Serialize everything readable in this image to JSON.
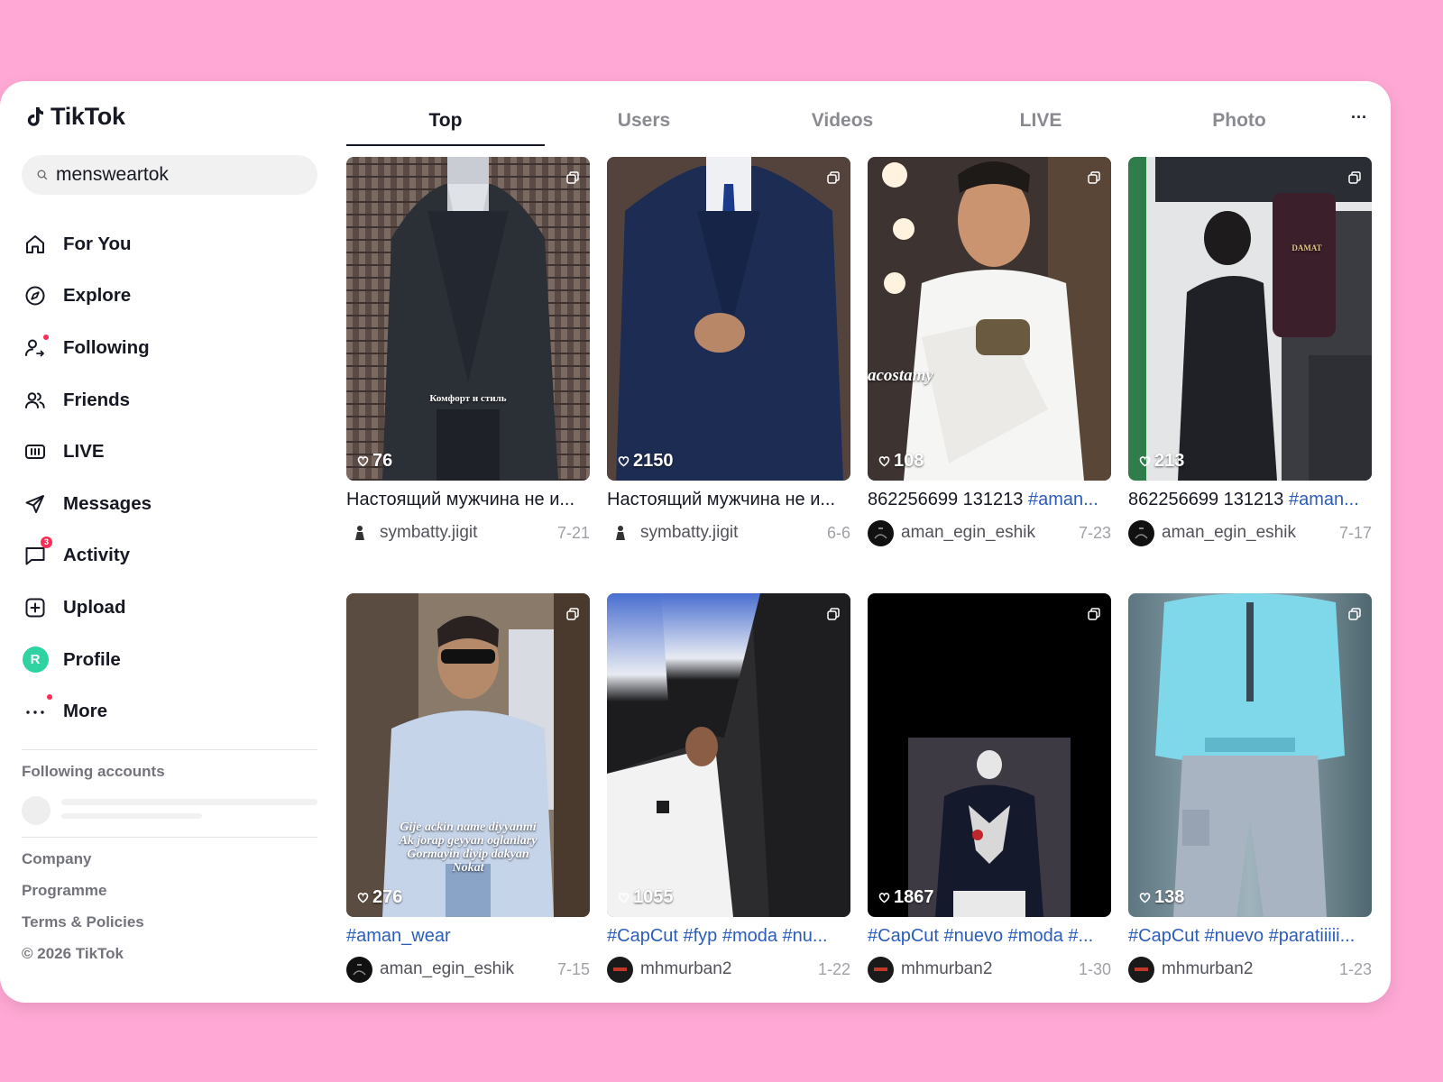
{
  "app": {
    "name": "TikTok"
  },
  "search": {
    "value": "mensweartok"
  },
  "nav": [
    {
      "label": "For You",
      "icon": "home-icon"
    },
    {
      "label": "Explore",
      "icon": "compass-icon"
    },
    {
      "label": "Following",
      "icon": "following-icon"
    },
    {
      "label": "Friends",
      "icon": "friends-icon"
    },
    {
      "label": "LIVE",
      "icon": "live-icon"
    },
    {
      "label": "Messages",
      "icon": "send-icon"
    },
    {
      "label": "Activity",
      "icon": "chat-icon",
      "badge": "3"
    },
    {
      "label": "Upload",
      "icon": "upload-icon"
    },
    {
      "label": "Profile",
      "icon": "avatar",
      "avatar_letter": "R"
    },
    {
      "label": "More",
      "icon": "more-icon"
    }
  ],
  "following_accounts": {
    "title": "Following accounts"
  },
  "footer": {
    "links": [
      "Company",
      "Programme",
      "Terms & Policies"
    ],
    "copyright": "© 2026 TikTok"
  },
  "tabs": [
    "Top",
    "Users",
    "Videos",
    "LIVE",
    "Photo"
  ],
  "active_tab": "Top",
  "more_tabs": "···",
  "videos": [
    {
      "likes": "76",
      "caption": "Настоящий мужчина не и...",
      "user": "symbatty.jigit",
      "date": "7-21",
      "overlay": "Комфорт и стиль"
    },
    {
      "likes": "2150",
      "caption": "Настоящий мужчина не и...",
      "user": "symbatty.jigit",
      "date": "6-6"
    },
    {
      "likes": "108",
      "caption_text": "862256699 131213 ",
      "caption_tag": "#aman...",
      "user": "aman_egin_eshik",
      "date": "7-23",
      "overlay": "acostamy"
    },
    {
      "likes": "213",
      "caption_text": "862256699 131213 ",
      "caption_tag": "#aman...",
      "user": "aman_egin_eshik",
      "date": "7-17",
      "overlay": "DAMAT"
    },
    {
      "likes": "276",
      "caption": "#aman_wear",
      "user": "aman_egin_eshik",
      "date": "7-15",
      "overlay_lines": [
        "Gije ackin name diyyanmi",
        "Ak jorap geyyan oglanlary",
        "Gormayin diyip dakyan",
        "Nokat"
      ]
    },
    {
      "likes": "1055",
      "caption": "#CapCut #fyp #moda #nu...",
      "user": "mhmurban2",
      "date": "1-22"
    },
    {
      "likes": "1867",
      "caption": "#CapCut #nuevo #moda #...",
      "user": "mhmurban2",
      "date": "1-30"
    },
    {
      "likes": "138",
      "caption": "#CapCut #nuevo #paratiiiii...",
      "user": "mhmurban2",
      "date": "1-23"
    }
  ],
  "colors": {
    "background": "#ffa8d5",
    "accent": "#fe2c55",
    "hashtag": "#2b5db9",
    "profile_avatar": "#2fd3a2"
  }
}
